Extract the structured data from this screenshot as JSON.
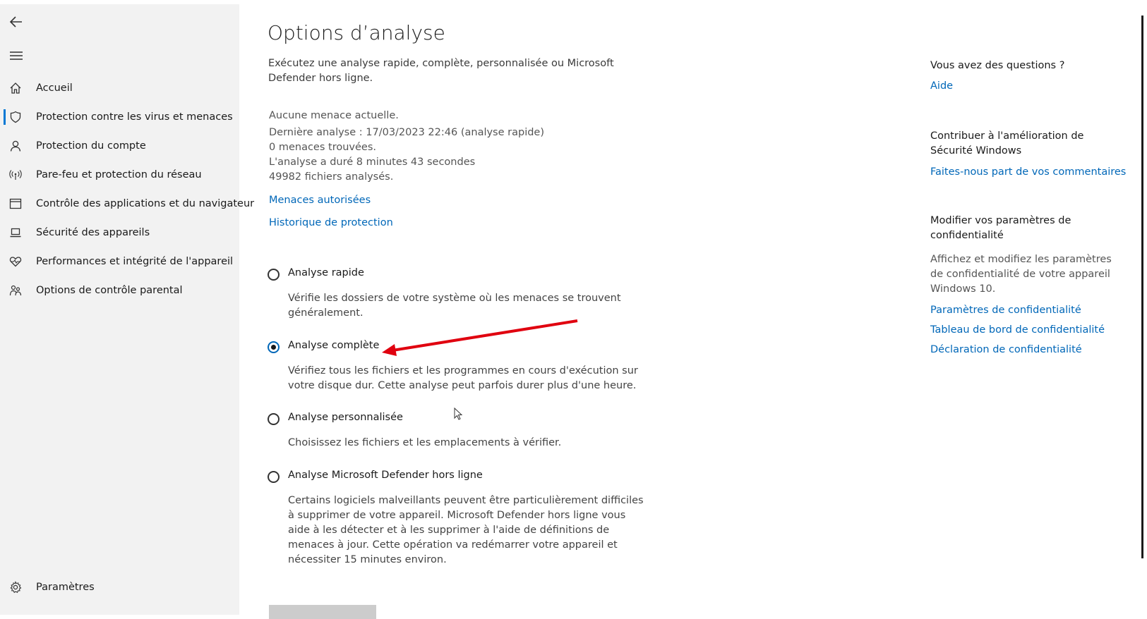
{
  "sidebar": {
    "items": [
      {
        "label": "Accueil",
        "icon": "home-icon"
      },
      {
        "label": "Protection contre les virus et menaces",
        "icon": "shield-icon"
      },
      {
        "label": "Protection du compte",
        "icon": "person-icon"
      },
      {
        "label": "Pare-feu et protection du réseau",
        "icon": "wifi-antenna-icon"
      },
      {
        "label": "Contrôle des applications et du navigateur",
        "icon": "app-window-icon"
      },
      {
        "label": "Sécurité des appareils",
        "icon": "laptop-icon"
      },
      {
        "label": "Performances et intégrité de l'appareil",
        "icon": "heart-icon"
      },
      {
        "label": "Options de contrôle parental",
        "icon": "family-icon"
      }
    ],
    "settings_label": "Paramètres"
  },
  "main": {
    "title": "Options d’analyse",
    "description": "Exécutez une analyse rapide, complète, personnalisée ou Microsoft Defender hors ligne.",
    "status": {
      "line1": "Aucune menace actuelle.",
      "line2": "Dernière analyse : 17/03/2023 22:46 (analyse rapide)",
      "line3": "0 menaces trouvées.",
      "line4": "L'analyse a duré 8 minutes 43 secondes",
      "line5": "49982 fichiers analysés."
    },
    "links": {
      "allowed_threats": "Menaces autorisées",
      "protection_history": "Historique de protection"
    },
    "options": [
      {
        "title": "Analyse rapide",
        "desc": "Vérifie les dossiers de votre système où les menaces se trouvent généralement.",
        "checked": false
      },
      {
        "title": "Analyse complète",
        "desc": "Vérifiez tous les fichiers et les programmes en cours d'exécution sur votre disque dur. Cette analyse peut parfois durer plus d'une heure.",
        "checked": true
      },
      {
        "title": "Analyse personnalisée",
        "desc": "Choisissez les fichiers et les emplacements à vérifier.",
        "checked": false
      },
      {
        "title": "Analyse Microsoft Defender hors ligne",
        "desc": "Certains logiciels malveillants peuvent être particulièrement difficiles à supprimer de votre appareil. Microsoft Defender hors ligne vous aide à les détecter et à les supprimer à l'aide de définitions de menaces à jour. Cette opération va redémarrer votre appareil et nécessiter 15 minutes environ.",
        "checked": false
      }
    ]
  },
  "right": {
    "questions_heading": "Vous avez des questions ?",
    "help_link": "Aide",
    "contribute_heading": "Contribuer à l'amélioration de Sécurité Windows",
    "feedback_link": "Faites-nous part de vos commentaires",
    "privacy_heading": "Modifier vos paramètres de confidentialité",
    "privacy_desc": "Affichez et modifiez les paramètres de confidentialité de votre appareil Windows 10.",
    "privacy_links": [
      "Paramètres de confidentialité",
      "Tableau de bord de confidentialité",
      "Déclaration de confidentialité"
    ]
  },
  "colors": {
    "accent": "#0067b8",
    "sidebar_bg": "#f2f2f2",
    "annotation_arrow": "#e0000f"
  }
}
